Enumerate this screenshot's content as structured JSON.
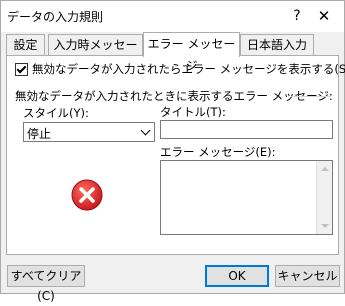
{
  "window": {
    "title": "データの入力規則",
    "help": "?",
    "close": "✕"
  },
  "tabs": [
    {
      "label": "設定"
    },
    {
      "label": "入力時メッセージ"
    },
    {
      "label": "エラー メッセージ"
    },
    {
      "label": "日本語入力"
    }
  ],
  "active_tab": "エラー メッセージ",
  "show_error_checkbox": {
    "label": "無効なデータが入力されたらエラー メッセージを表示する(S)",
    "checked": true
  },
  "group_label": "無効なデータが入力されたときに表示するエラー メッセージ:",
  "style": {
    "label": "スタイル(Y):",
    "value": "停止"
  },
  "title_field": {
    "label": "タイトル(T):",
    "value": ""
  },
  "message_field": {
    "label": "エラー メッセージ(E):",
    "value": ""
  },
  "icons": {
    "stop": "error-stop-icon"
  },
  "buttons": {
    "clear_all": "すべてクリア(C)",
    "ok": "OK",
    "cancel": "キャンセル"
  },
  "colors": {
    "accent": "#0078d7",
    "stop_red": "#d9302f"
  }
}
